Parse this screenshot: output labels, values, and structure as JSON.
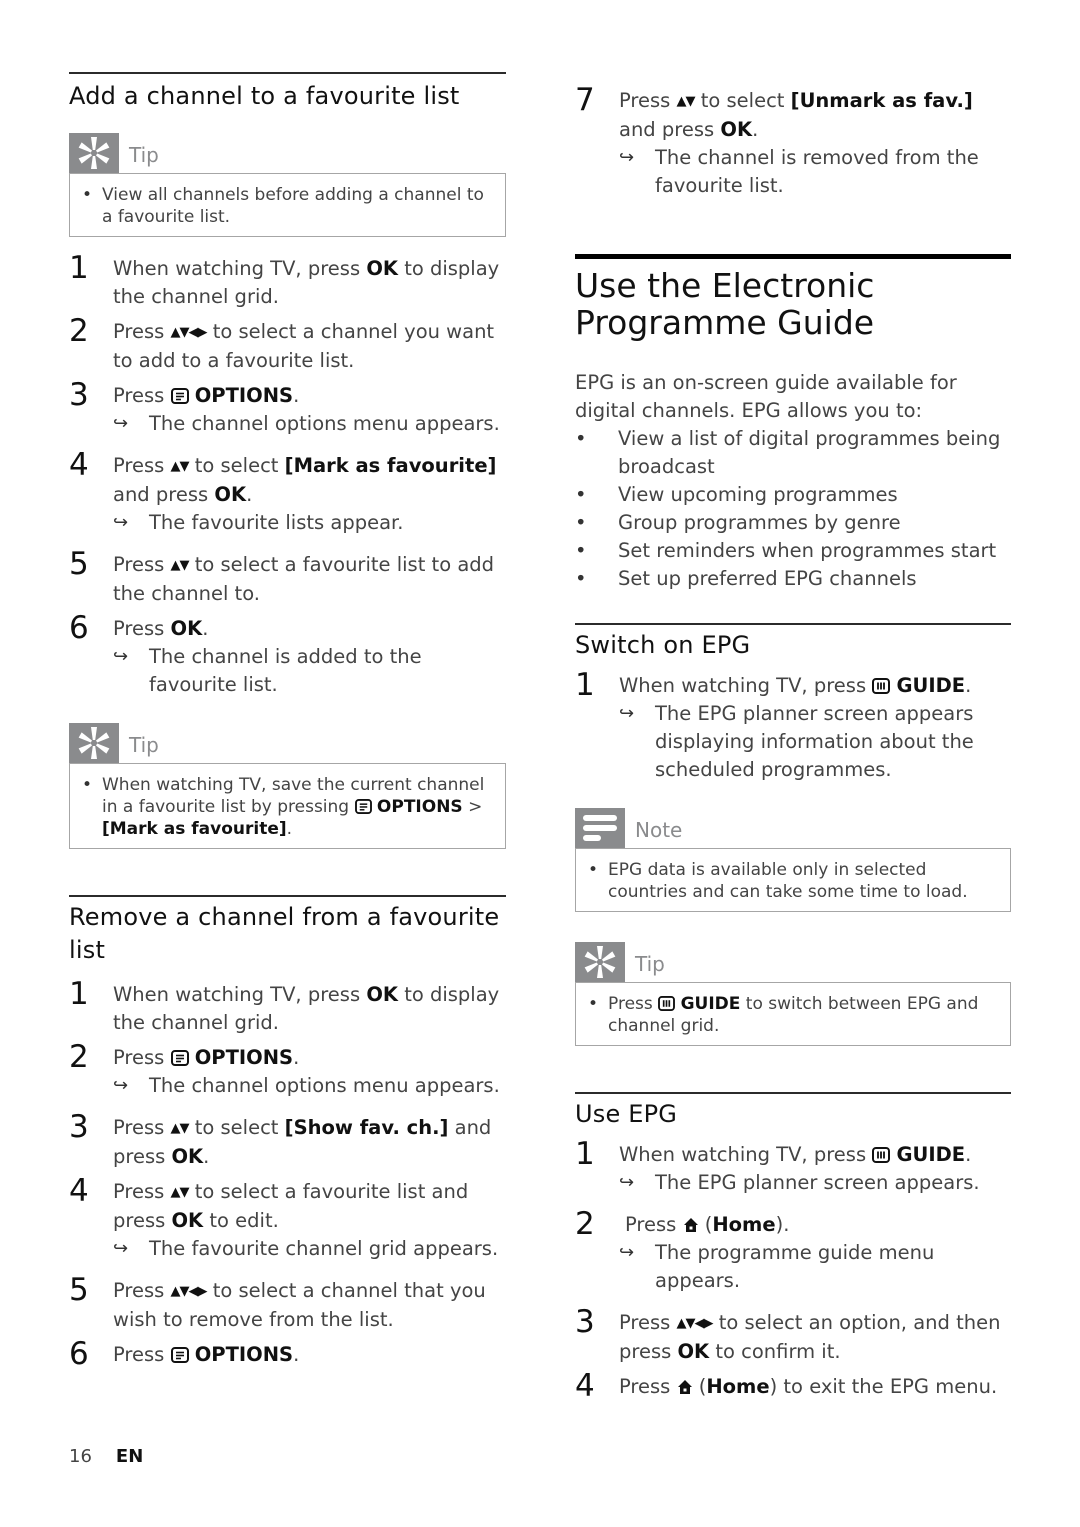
{
  "left": {
    "section1": {
      "title": "Add a channel to a favourite list",
      "tip1": {
        "label": "Tip",
        "text": "View all channels before adding a channel to a favourite list."
      },
      "steps": [
        {
          "n": "1",
          "pre": "When watching TV, press ",
          "key": "OK",
          "post": " to display the channel grid."
        },
        {
          "n": "2",
          "pre": "Press ",
          "arrows": "▲▼◀▶",
          "post": " to select a channel you want to add to a favourite list."
        },
        {
          "n": "3",
          "pre": "Press ",
          "icon": "options-icon",
          "key": "OPTIONS",
          "post": ".",
          "result": "The channel options menu appears."
        },
        {
          "n": "4",
          "pre": "Press ",
          "arrows": "▲▼",
          "mid": " to select ",
          "key": "[Mark as favourite]",
          "post2": " and press ",
          "key2": "OK",
          "post": ".",
          "result": "The favourite lists appear."
        },
        {
          "n": "5",
          "pre": "Press ",
          "arrows": "▲▼",
          "post": " to select a favourite list to add the channel to."
        },
        {
          "n": "6",
          "pre": "Press ",
          "key": "OK",
          "post": ".",
          "result": "The channel is added to the favourite list."
        }
      ],
      "tip2": {
        "label": "Tip",
        "pre": "When watching TV, save the current channel in a favourite list by pressing ",
        "key": "OPTIONS",
        "sep": " > ",
        "key2": "[Mark as favourite]",
        "post": "."
      }
    },
    "section2": {
      "title": "Remove a channel from a favourite list",
      "steps": [
        {
          "n": "1",
          "pre": "When watching TV, press ",
          "key": "OK",
          "post": " to display the channel grid."
        },
        {
          "n": "2",
          "pre": "Press ",
          "key": "OPTIONS",
          "post": ".",
          "result": "The channel options menu appears."
        },
        {
          "n": "3",
          "pre": "Press ",
          "arrows": "▲▼",
          "mid": " to select ",
          "key": "[Show fav. ch.]",
          "post2": " and press ",
          "key2": "OK",
          "post": "."
        },
        {
          "n": "4",
          "pre": "Press ",
          "arrows": "▲▼",
          "mid": " to select a favourite list and press ",
          "key": "OK",
          "post": " to edit.",
          "result": "The favourite channel grid appears."
        },
        {
          "n": "5",
          "pre": "Press ",
          "arrows": "▲▼◀▶",
          "post": " to select a channel that you wish to remove from the list."
        },
        {
          "n": "6",
          "pre": "Press ",
          "key": "OPTIONS",
          "post": "."
        }
      ]
    }
  },
  "right": {
    "step7": {
      "n": "7",
      "pre": "Press ",
      "arrows": "▲▼",
      "mid": " to select ",
      "key": "[Unmark as fav.]",
      "post2": " and press ",
      "key2": "OK",
      "post": ".",
      "result": "The channel is removed from the favourite list."
    },
    "epg": {
      "title": "Use the Electronic Programme Guide",
      "intro": "EPG is an on-screen guide available for digital channels. EPG allows you to:",
      "bullets": [
        "View a list of digital programmes being broadcast",
        "View upcoming programmes",
        "Group programmes by genre",
        "Set reminders when programmes start",
        "Set up preferred EPG channels"
      ]
    },
    "switch_on": {
      "title": "Switch on EPG",
      "step1": {
        "n": "1",
        "pre": "When watching TV, press ",
        "key": "GUIDE",
        "post": ".",
        "result": "The EPG planner screen appears displaying information about the scheduled programmes."
      },
      "note": {
        "label": "Note",
        "text": "EPG data is available only in selected countries and can take some time to load."
      },
      "tip": {
        "label": "Tip",
        "pre": "Press ",
        "key": "GUIDE",
        "post": " to switch between EPG and channel grid."
      }
    },
    "use_epg": {
      "title": "Use EPG",
      "steps": [
        {
          "n": "1",
          "pre": "When watching TV, press ",
          "key": "GUIDE",
          "post": ".",
          "result": "The EPG planner screen appears."
        },
        {
          "n": "2",
          "pre": "Press ",
          "mid": " (",
          "key": "Home",
          "post": ").",
          "result": "The programme guide menu appears."
        },
        {
          "n": "3",
          "pre": "Press ",
          "arrows": "▲▼◀▶",
          "mid": " to select an option, and then press ",
          "key": "OK",
          "post": " to confirm it."
        },
        {
          "n": "4",
          "pre": "Press ",
          "mid": " (",
          "key": "Home",
          "post": ") to exit the EPG menu."
        }
      ]
    }
  },
  "footer": {
    "page": "16",
    "lang": "EN"
  },
  "result_arrow": "↪"
}
